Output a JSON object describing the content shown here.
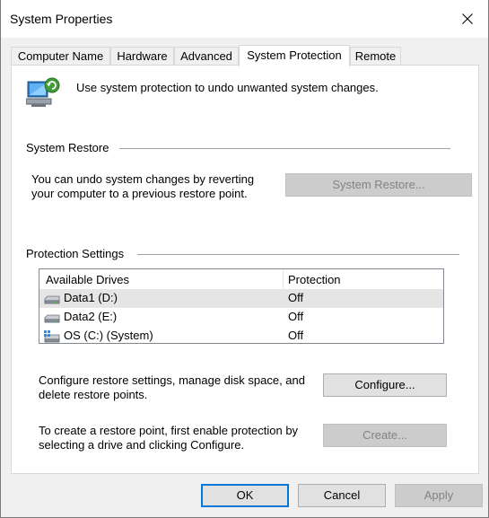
{
  "window": {
    "title": "System Properties"
  },
  "tabs": [
    {
      "label": "Computer Name"
    },
    {
      "label": "Hardware"
    },
    {
      "label": "Advanced"
    },
    {
      "label": "System Protection",
      "active": true
    },
    {
      "label": "Remote"
    }
  ],
  "intro": {
    "text": "Use system protection to undo unwanted system changes."
  },
  "system_restore": {
    "heading": "System Restore",
    "description_line1": "You can undo system changes by reverting",
    "description_line2": "your computer to a previous restore point.",
    "button_label": "System Restore...",
    "button_enabled": false
  },
  "protection_settings": {
    "heading": "Protection Settings",
    "columns": {
      "drives": "Available Drives",
      "protection": "Protection"
    },
    "drives": [
      {
        "name": "Data1 (D:)",
        "protection": "Off",
        "icon": "hard-drive-icon",
        "selected": true
      },
      {
        "name": "Data2 (E:)",
        "protection": "Off",
        "icon": "hard-drive-icon",
        "selected": false
      },
      {
        "name": "OS (C:) (System)",
        "protection": "Off",
        "icon": "windows-drive-icon",
        "selected": false
      }
    ],
    "configure_text_line1": "Configure restore settings, manage disk space, and",
    "configure_text_line2": "delete restore points.",
    "configure_button": "Configure...",
    "create_text_line1": "To create a restore point, first enable protection by",
    "create_text_line2": "selecting a drive and clicking Configure.",
    "create_button": "Create...",
    "create_enabled": false
  },
  "footer": {
    "ok": "OK",
    "cancel": "Cancel",
    "apply": "Apply",
    "apply_enabled": false
  },
  "colors": {
    "accent": "#0078d7",
    "window_bg": "#f0f0f0",
    "panel_bg": "#ffffff",
    "disabled_text": "#838383"
  }
}
